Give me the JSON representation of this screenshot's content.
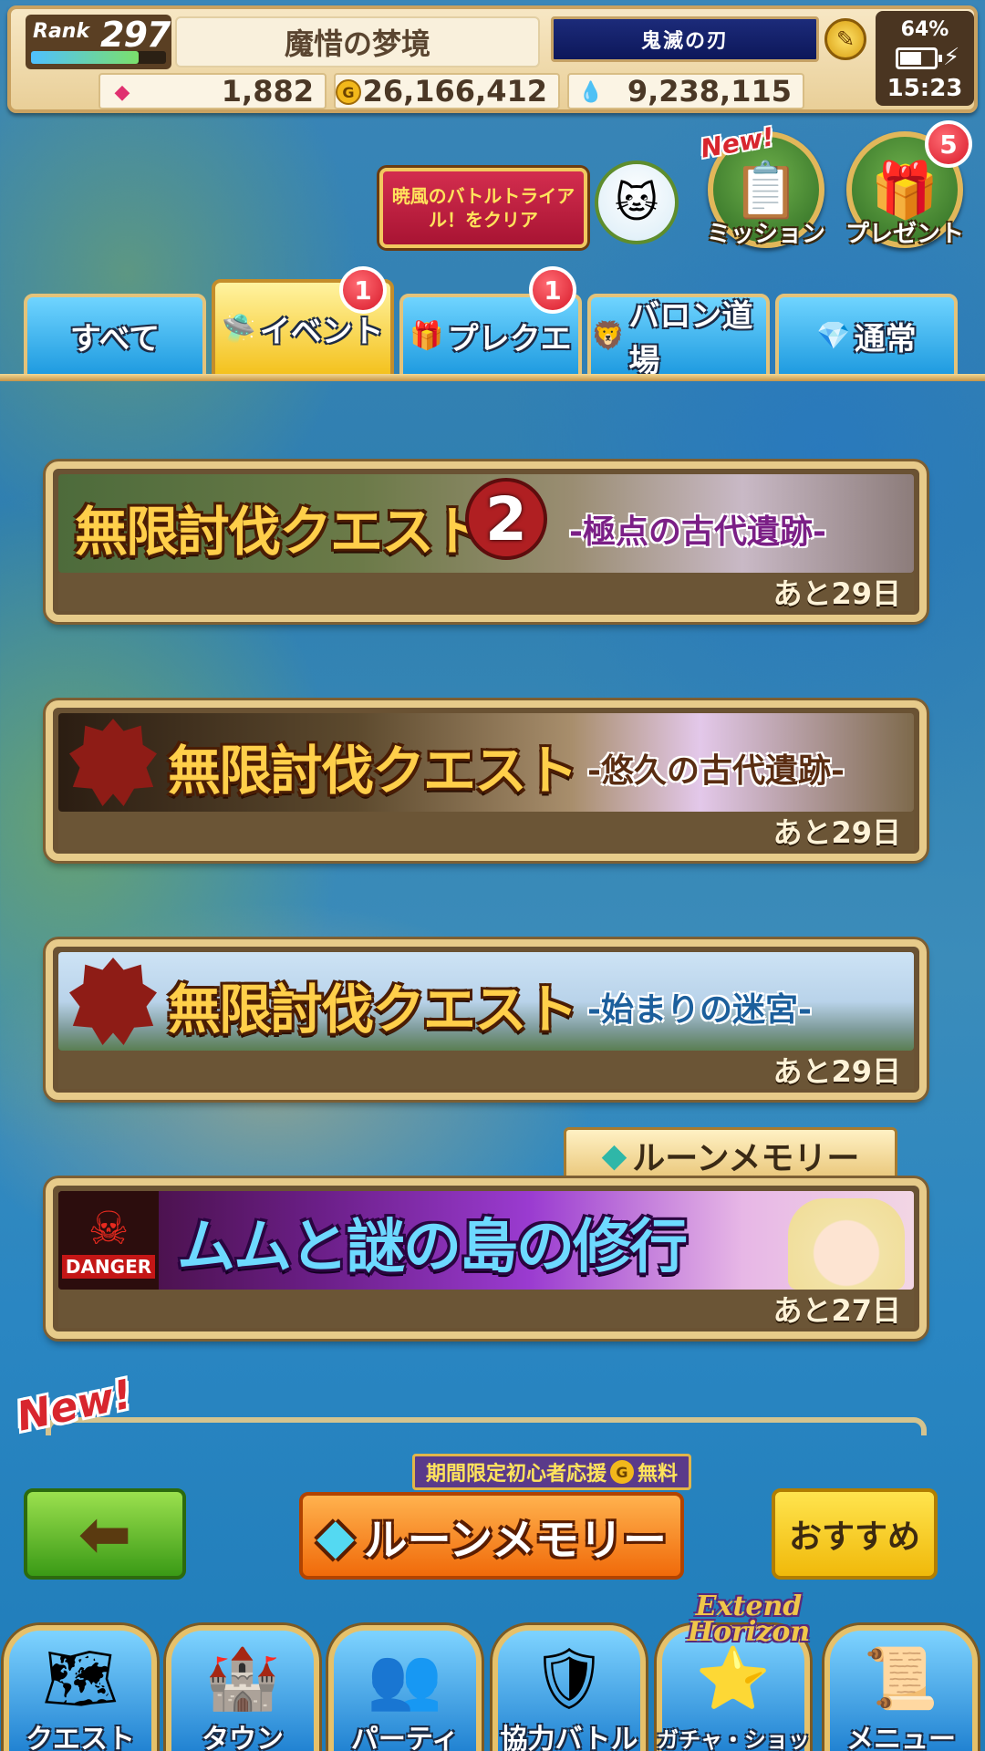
{
  "status": {
    "rank_label": "Rank",
    "rank_value": "297",
    "rank_progress": 0.8,
    "title": "魔惜の梦境",
    "badge": "鬼滅の刃",
    "battery": "64%",
    "battery_level": 0.64,
    "time": "15:23"
  },
  "currency": {
    "gems": "1,882",
    "gold": "26,166,412",
    "soul": "9,238,115"
  },
  "header": {
    "clear_banner": "暁風のバトルトライアル！をクリア",
    "mission_label": "ミッション",
    "present_label": "プレゼント",
    "new_tag": "New!",
    "present_count": "5"
  },
  "tabs": [
    {
      "label": "すべて",
      "badge": ""
    },
    {
      "label": "イベント",
      "badge": "1"
    },
    {
      "label": "プレクエ",
      "badge": "1"
    },
    {
      "label": "バロン道場",
      "badge": ""
    },
    {
      "label": "通常",
      "badge": ""
    }
  ],
  "quests": [
    {
      "title": "無限討伐クエスト",
      "number": "2",
      "subtitle": "-極点の古代遺跡-",
      "remaining": "あと29日"
    },
    {
      "title": "無限討伐クエスト",
      "subtitle": "-悠久の古代遺跡-",
      "remaining": "あと29日"
    },
    {
      "title": "無限討伐クエスト",
      "subtitle": "-始まりの迷宮-",
      "remaining": "あと29日"
    },
    {
      "title": "ムムと謎の島の修行",
      "danger": "DANGER",
      "remaining": "あと27日",
      "ribbon": "ルーンメモリー"
    }
  ],
  "list_new_tag": "New!",
  "actions": {
    "promo": "期間限定初心者応援",
    "promo_coin": "G",
    "promo_free": "無料",
    "rune_memory": "ルーンメモリー",
    "recommend": "おすすめ"
  },
  "nav": {
    "extend_line1": "Extend",
    "extend_line2": "Horizon",
    "items": [
      {
        "label": "クエスト"
      },
      {
        "label": "タウン"
      },
      {
        "label": "パーティ"
      },
      {
        "label": "協力バトル"
      },
      {
        "label": "ガチャ・ショップ"
      },
      {
        "label": "メニュー"
      }
    ]
  },
  "colors": {
    "tab_active": "#f4c21e",
    "tab_idle": "#1f9be0",
    "back_button": "#3a9a16",
    "rune_button": "#f06a0a",
    "badge_red": "#d81a2a"
  }
}
